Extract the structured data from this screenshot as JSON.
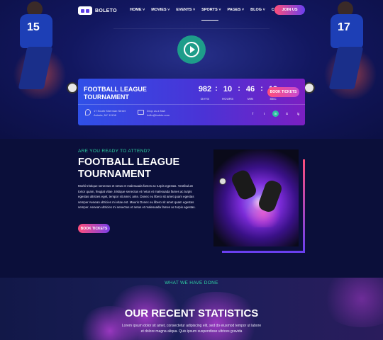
{
  "brand": {
    "name": "BOLETO"
  },
  "nav": {
    "items": [
      "HOME",
      "MOVIES",
      "EVENTS",
      "SPORTS",
      "PAGES",
      "BLOG",
      "CONTACT"
    ],
    "dropdown_flags": [
      true,
      true,
      true,
      true,
      true,
      true,
      false
    ],
    "active_index": 3,
    "join_label": "JOIN US"
  },
  "countdown": {
    "title": "FOOTBALL LEAGUE TOURNAMENT",
    "days": "982",
    "hours": "10",
    "minutes": "46",
    "seconds": "19",
    "days_label": "DAYS",
    "hours_label": "HOURS",
    "min_label": "MIN",
    "sec_label": "SEC",
    "book_label": "BOOK TICKETS",
    "address_line1": "17 South Sherman Street",
    "address_line2": "Astoria, NY 11106",
    "mail_line1": "Drop us a Mail",
    "mail_line2": "hello@boleto.com",
    "socials": [
      "f",
      "t",
      "in",
      "G",
      "ig"
    ],
    "active_social": 2
  },
  "about": {
    "subtitle": "ARE YOU READY TO ATTEND?",
    "title": "FOOTBALL LEAGUE TOURNAMENT",
    "text": "Morbi tristique senectus et netus et malesuada fames ac turpis egestas. Vestibulum tortor quam, feugiat vitae, tristique senectus et netus et malesuada fames ac turpis egestas ultricies eget, tempor sit amet, ante. Donec eu libero sit amet quam egestas semper Aenean ultricies mi vitae est. Mauris Donec eu libero sit amet quam egestas semper. Aenean ultricies mi senectus et netus et malesuada fames ac turpis egestas.",
    "button_label": "BOOK TICKETS"
  },
  "stats": {
    "subtitle": "WHAT WE HAVE DONE",
    "title": "OUR RECENT STATISTICS",
    "text": "Lorem ipsum dolor sit amet, consectetur adipiscing elit, sed do eiusmod tempor ut labore et dolore magna aliqua. Quis ipsum suspendisse ultrices gravida"
  },
  "colors": {
    "accent_green": "#2ed1a2",
    "button_pink": "#ff4e7a",
    "button_purple": "#6a3ff0",
    "bg": "#0b0f3a"
  }
}
